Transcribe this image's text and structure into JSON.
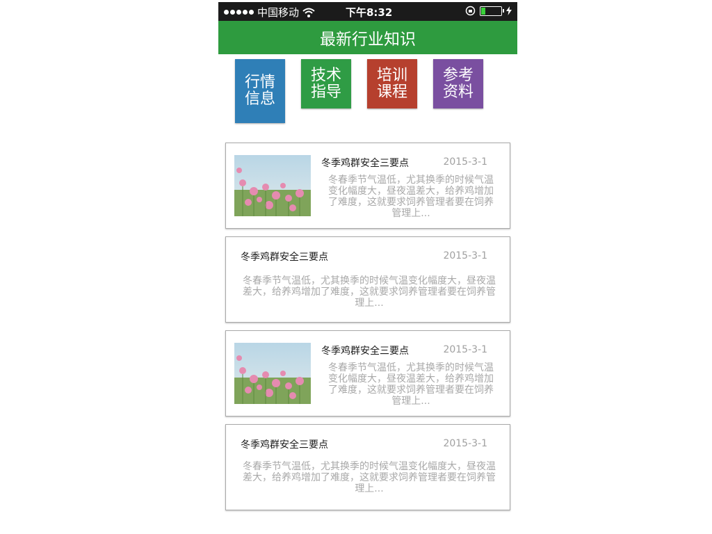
{
  "statusbar": {
    "carrier": "中国移动",
    "time": "下午8:32"
  },
  "header": {
    "title": "最新行业知识"
  },
  "categories": [
    {
      "label_line1": "行情",
      "label_line2": "信息",
      "color": "#2f7fb7"
    },
    {
      "label_line1": "技术",
      "label_line2": "指导",
      "color": "#2f9c45"
    },
    {
      "label_line1": "培训",
      "label_line2": "课程",
      "color": "#b6402e"
    },
    {
      "label_line1": "参考",
      "label_line2": "资料",
      "color": "#7a4fa0"
    }
  ],
  "articles": [
    {
      "has_image": true,
      "title": "冬季鸡群安全三要点",
      "date": "2015-3-1",
      "excerpt": "冬春季节气温低，尤其换季的时候气温变化幅度大，昼夜温差大，给养鸡增加了难度，这就要求饲养管理者要在饲养管理上..."
    },
    {
      "has_image": false,
      "title": "冬季鸡群安全三要点",
      "date": "2015-3-1",
      "excerpt": "冬春季节气温低，尤其换季的时候气温变化幅度大，昼夜温差大，给养鸡增加了难度，这就要求饲养管理者要在饲养管理上..."
    },
    {
      "has_image": true,
      "title": "冬季鸡群安全三要点",
      "date": "2015-3-1",
      "excerpt": "冬春季节气温低，尤其换季的时候气温变化幅度大，昼夜温差大，给养鸡增加了难度，这就要求饲养管理者要在饲养管理上..."
    },
    {
      "has_image": false,
      "title": "冬季鸡群安全三要点",
      "date": "2015-3-1",
      "excerpt": "冬春季节气温低，尤其换季的时候气温变化幅度大，昼夜温差大，给养鸡增加了难度，这就要求饲养管理者要在饲养管理上..."
    }
  ]
}
